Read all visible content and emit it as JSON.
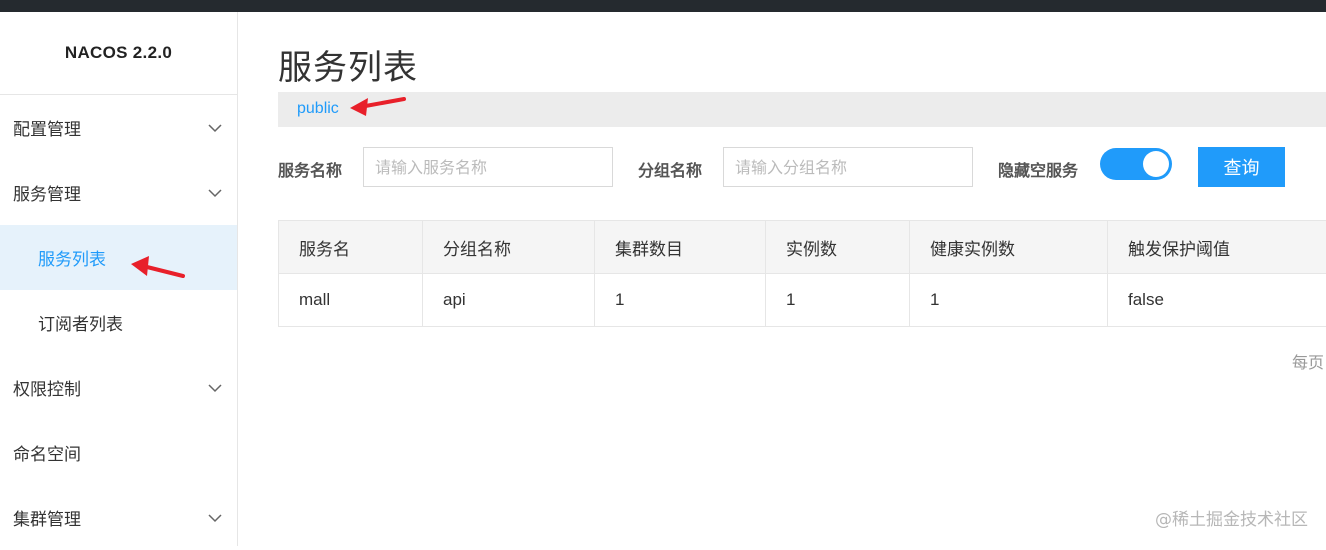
{
  "app": {
    "logo": "NACOS 2.2.0"
  },
  "sidebar": {
    "items": [
      {
        "label": "配置管理",
        "has_chevron": true
      },
      {
        "label": "服务管理",
        "has_chevron": true
      },
      {
        "label": "服务列表",
        "active": true
      },
      {
        "label": "订阅者列表"
      },
      {
        "label": "权限控制",
        "has_chevron": true
      },
      {
        "label": "命名空间"
      },
      {
        "label": "集群管理",
        "has_chevron": true
      }
    ]
  },
  "main": {
    "title": "服务列表",
    "namespace": "public",
    "filters": {
      "service_name_label": "服务名称",
      "service_name_placeholder": "请输入服务名称",
      "group_name_label": "分组名称",
      "group_name_placeholder": "请输入分组名称",
      "hide_empty_label": "隐藏空服务",
      "hide_empty_on": true,
      "query_label": "查询"
    },
    "table": {
      "columns": [
        "服务名",
        "分组名称",
        "集群数目",
        "实例数",
        "健康实例数",
        "触发保护阈值"
      ],
      "rows": [
        [
          "mall",
          "api",
          "1",
          "1",
          "1",
          "false"
        ]
      ]
    },
    "per_page_label": "每页"
  },
  "watermark": "@稀土掘金技术社区",
  "colors": {
    "accent": "#209bfa",
    "topbar": "#252a2f",
    "annotation_arrow": "#e8202a"
  }
}
